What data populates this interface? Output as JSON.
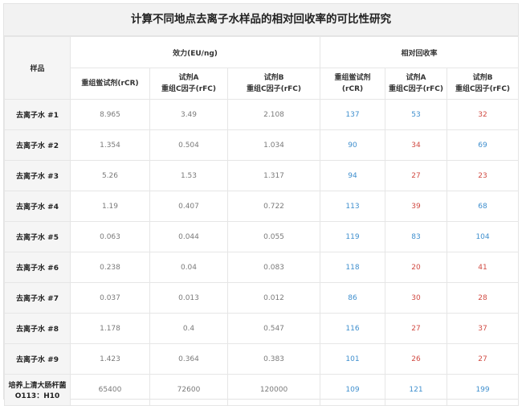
{
  "title": "计算不同地点去离子水样品的相对回收率的可比性研究",
  "header": {
    "sample": "样品",
    "potency_group": "效力(EU/ng)",
    "recovery_group": "相对回收率",
    "col_rcr_line1": "重组鲎试剂",
    "col_rcr_line2": "(rCR)",
    "col_a_line1": "试剂A",
    "col_a_line2": "重组C因子(rFC)",
    "col_b_line1": "试剂B",
    "col_b_line2": "重组C因子(rFC)",
    "rec_rcr_line1": "重组鲎试剂",
    "rec_rcr_line2": "(rCR)",
    "rec_a_line1": "试剂A",
    "rec_a_line2": "重组C因子(rFC)",
    "rec_b_line1": "试剂B",
    "rec_b_line2": "重组C因子(rFC)"
  },
  "colors": {
    "blue": "#3f8fce",
    "red": "#d14b43",
    "grey": "#7a7a7a"
  },
  "rows": [
    {
      "sample": "去离子水 #1",
      "p_rcr": "8.965",
      "p_a": "3.49",
      "p_b": "2.108",
      "r_rcr": "137",
      "r_a": "53",
      "r_b": "32",
      "r_rcr_c": "blue",
      "r_a_c": "blue",
      "r_b_c": "red"
    },
    {
      "sample": "去离子水 #2",
      "p_rcr": "1.354",
      "p_a": "0.504",
      "p_b": "1.034",
      "r_rcr": "90",
      "r_a": "34",
      "r_b": "69",
      "r_rcr_c": "blue",
      "r_a_c": "red",
      "r_b_c": "blue"
    },
    {
      "sample": "去离子水 #3",
      "p_rcr": "5.26",
      "p_a": "1.53",
      "p_b": "1.317",
      "r_rcr": "94",
      "r_a": "27",
      "r_b": "23",
      "r_rcr_c": "blue",
      "r_a_c": "red",
      "r_b_c": "red"
    },
    {
      "sample": "去离子水 #4",
      "p_rcr": "1.19",
      "p_a": "0.407",
      "p_b": "0.722",
      "r_rcr": "113",
      "r_a": "39",
      "r_b": "68",
      "r_rcr_c": "blue",
      "r_a_c": "red",
      "r_b_c": "blue"
    },
    {
      "sample": "去离子水 #5",
      "p_rcr": "0.063",
      "p_a": "0.044",
      "p_b": "0.055",
      "r_rcr": "119",
      "r_a": "83",
      "r_b": "104",
      "r_rcr_c": "blue",
      "r_a_c": "blue",
      "r_b_c": "blue"
    },
    {
      "sample": "去离子水 #6",
      "p_rcr": "0.238",
      "p_a": "0.04",
      "p_b": "0.083",
      "r_rcr": "118",
      "r_a": "20",
      "r_b": "41",
      "r_rcr_c": "blue",
      "r_a_c": "red",
      "r_b_c": "red"
    },
    {
      "sample": "去离子水 #7",
      "p_rcr": "0.037",
      "p_a": "0.013",
      "p_b": "0.012",
      "r_rcr": "86",
      "r_a": "30",
      "r_b": "28",
      "r_rcr_c": "blue",
      "r_a_c": "red",
      "r_b_c": "red"
    },
    {
      "sample": "去离子水 #8",
      "p_rcr": "1.178",
      "p_a": "0.4",
      "p_b": "0.547",
      "r_rcr": "116",
      "r_a": "27",
      "r_b": "37",
      "r_rcr_c": "blue",
      "r_a_c": "red",
      "r_b_c": "red"
    },
    {
      "sample": "去离子水 #9",
      "p_rcr": "1.423",
      "p_a": "0.364",
      "p_b": "0.383",
      "r_rcr": "101",
      "r_a": "26",
      "r_b": "27",
      "r_rcr_c": "blue",
      "r_a_c": "red",
      "r_b_c": "red"
    },
    {
      "sample_line1": "培养上清大肠杆菌",
      "sample_line2": "O113：H10",
      "p_rcr": "65400",
      "p_a": "72600",
      "p_b": "120000",
      "r_rcr": "109",
      "r_a": "121",
      "r_b": "199",
      "r_rcr_c": "blue",
      "r_a_c": "blue",
      "r_b_c": "blue"
    }
  ]
}
